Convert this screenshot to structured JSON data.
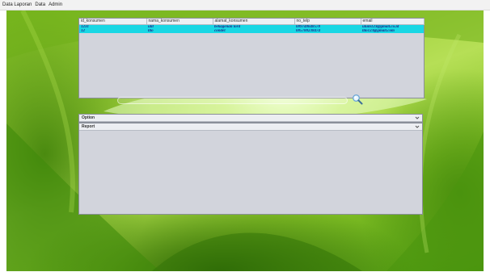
{
  "menubar": {
    "items": [
      "Data Laporan",
      "Data",
      "Admin"
    ]
  },
  "table": {
    "columns": [
      "id_konsumen",
      "nama_konsumen",
      "alamat_konsumen",
      "no_telp",
      "email"
    ],
    "rows": [
      [
        "1231",
        "ulil",
        "bekagenan lord",
        "089748648578",
        "ulum123@gmail.co.id"
      ],
      [
        "12",
        "tito",
        "condet",
        "085788238474",
        "tito123@gmail.com"
      ]
    ]
  },
  "search": {
    "value": ""
  },
  "panels": {
    "option_title": "Option",
    "report_title": "Report"
  },
  "icons": {
    "search": "search-icon",
    "collapse": "chevron-down-icon"
  },
  "colors": {
    "row_highlight": "#19d7e4",
    "row_text": "#1a2a8c",
    "panel_bg": "#d2d4dc"
  }
}
